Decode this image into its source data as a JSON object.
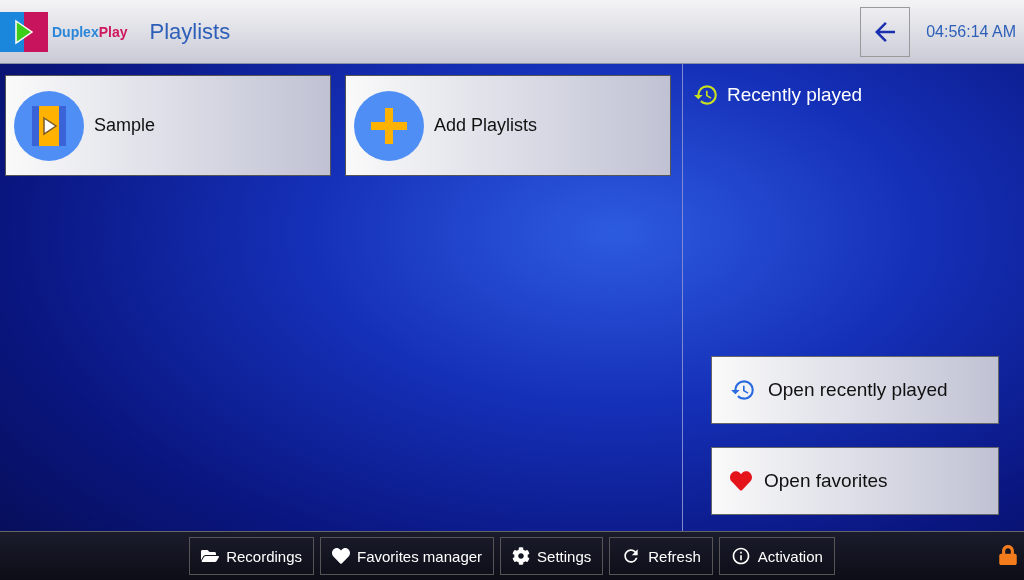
{
  "header": {
    "logo_text": [
      "Duplex",
      "Play"
    ],
    "title": "Playlists",
    "time": "04:56:14 AM"
  },
  "playlists": [
    {
      "kind": "playlist",
      "label": "Sample"
    },
    {
      "kind": "add",
      "label": "Add Playlists"
    }
  ],
  "recent": {
    "title": "Recently played"
  },
  "actions": [
    {
      "kind": "history",
      "label": "Open recently played"
    },
    {
      "kind": "heart",
      "label": "Open favorites"
    }
  ],
  "footer": [
    {
      "kind": "folder",
      "label": "Recordings"
    },
    {
      "kind": "heart",
      "label": "Favorites manager"
    },
    {
      "kind": "gear",
      "label": "Settings"
    },
    {
      "kind": "refresh",
      "label": "Refresh"
    },
    {
      "kind": "info",
      "label": "Activation"
    }
  ]
}
